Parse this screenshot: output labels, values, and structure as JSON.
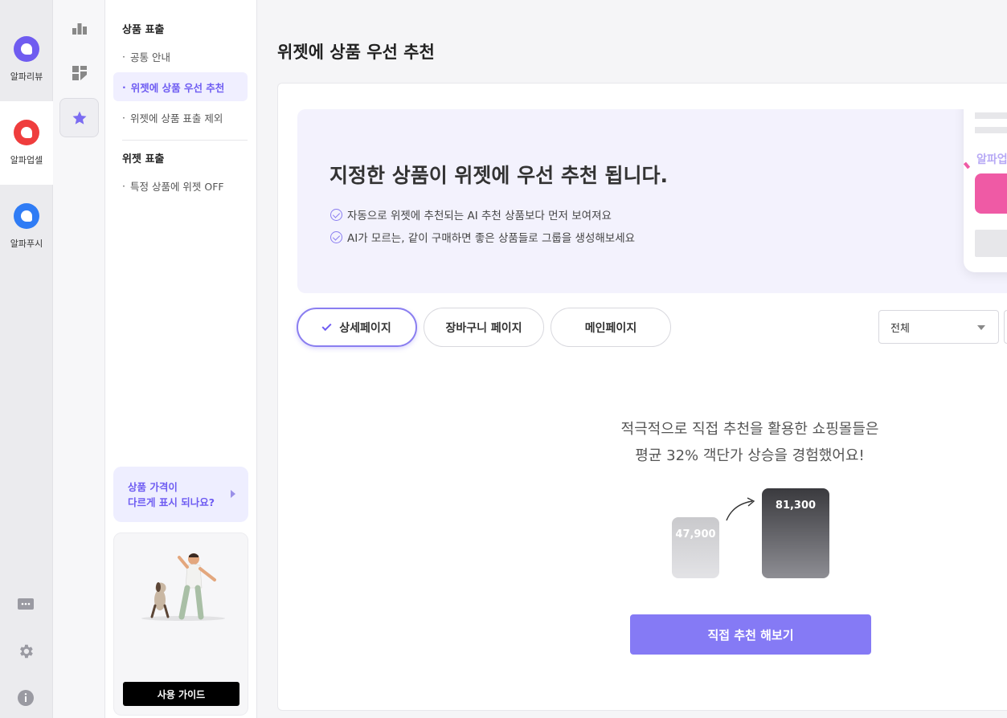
{
  "rail": {
    "apps": [
      {
        "label": "알파리뷰",
        "color": "#6f5cf0"
      },
      {
        "label": "알파업셀",
        "color": "#ef3d3d"
      },
      {
        "label": "알파푸시",
        "color": "#2f7cf5"
      }
    ],
    "bottom_icons": [
      "chat-icon",
      "gear-icon",
      "info-icon"
    ]
  },
  "iconcol": {
    "icons": [
      "bar-chart-icon",
      "dashboard-icon",
      "star-icon"
    ],
    "accent": "#7b6cf2"
  },
  "submenu": {
    "section1_title": "상품 표출",
    "section1_items": [
      "공통 안내",
      "위젯에 상품 우선 추천",
      "위젯에 상품 표출 제외"
    ],
    "section2_title": "위젯 표출",
    "section2_items": [
      "특정 상품에 위젯 OFF"
    ],
    "help_card": {
      "line1": "상품 가격이",
      "line2": "다르게 표시 되나요?"
    },
    "guide_button": "사용 가이드"
  },
  "main": {
    "page_title": "위젯에 상품 우선 추천",
    "banner": {
      "title": "지정한 상품이 위젯에 우선 추천 됩니다.",
      "checks": [
        "자동으로 위젯에 추천되는 AI 추천 상품보다 먼저 보여져요",
        "AI가 모르는, 같이 구매하면 좋은 상품들로 그룹을 생성해보세요"
      ],
      "phone_label": "알파업"
    },
    "tabs": [
      "상세페이지",
      "장바구니 페이지",
      "메인페이지"
    ],
    "filter": {
      "selected": "전체"
    },
    "promo": {
      "line1": "적극적으로 직접 추천을 활용한 쇼핑몰들은",
      "line2": "평균 32% 객단가 상승을 경험했어요!"
    },
    "compare": {
      "before": "47,900",
      "after": "81,300"
    },
    "cta": "직접 추천 해보기"
  }
}
